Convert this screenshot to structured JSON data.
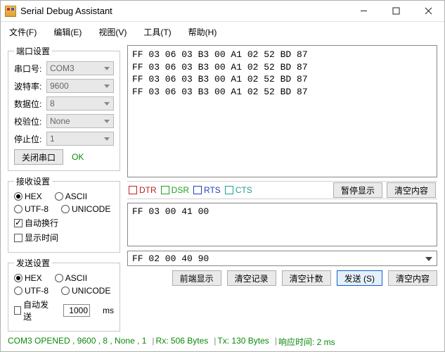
{
  "window": {
    "title": "Serial Debug Assistant"
  },
  "menu": {
    "file": "文件(F)",
    "edit": "编辑(E)",
    "view": "视图(V)",
    "tool": "工具(T)",
    "help": "帮助(H)"
  },
  "port": {
    "legend": "端口设置",
    "name_label": "串口号:",
    "name_value": "COM3",
    "baud_label": "波特率:",
    "baud_value": "9600",
    "data_label": "数据位:",
    "data_value": "8",
    "parity_label": "校验位:",
    "parity_value": "None",
    "stop_label": "停止位:",
    "stop_value": "1",
    "close_btn": "关闭串口",
    "ok_text": "OK"
  },
  "recv": {
    "legend": "接收设置",
    "hex": "HEX",
    "ascii": "ASCII",
    "utf8": "UTF-8",
    "unicode": "UNICODE",
    "wrap": "自动换行",
    "showtime": "显示时间"
  },
  "send": {
    "legend": "发送设置",
    "hex": "HEX",
    "ascii": "ASCII",
    "utf8": "UTF-8",
    "unicode": "UNICODE",
    "auto_send": "自动发送",
    "auto_interval": "1000",
    "auto_unit": "ms"
  },
  "rx_data": "FF 03 06 03 B3 00 A1 02 52 BD 87\nFF 03 06 03 B3 00 A1 02 52 BD 87\nFF 03 06 03 B3 00 A1 02 52 BD 87\nFF 03 06 03 B3 00 A1 02 52 BD 87",
  "lines": {
    "dtr": "DTR",
    "dsr": "DSR",
    "rts": "RTS",
    "cts": "CTS",
    "pause_btn": "暂停显示",
    "clear_rx_btn": "清空内容"
  },
  "tx_data": "FF 03 00 41 00",
  "send_combo_value": "FF 02 00 40 90",
  "actions": {
    "front": "前端显示",
    "clear_log": "清空记录",
    "clear_count": "清空计数",
    "send": "发送 (S)",
    "clear_tx": "清空内容"
  },
  "status": {
    "port": "COM3 OPENED , 9600 , 8 , None , 1",
    "rx_label": "Rx:",
    "rx_value": "506",
    "bytes1": "Bytes",
    "tx_label": "Tx:",
    "tx_value": "130",
    "bytes2": "Bytes",
    "resp_label": "响应时间:",
    "resp_value": "2",
    "resp_unit": "ms"
  }
}
